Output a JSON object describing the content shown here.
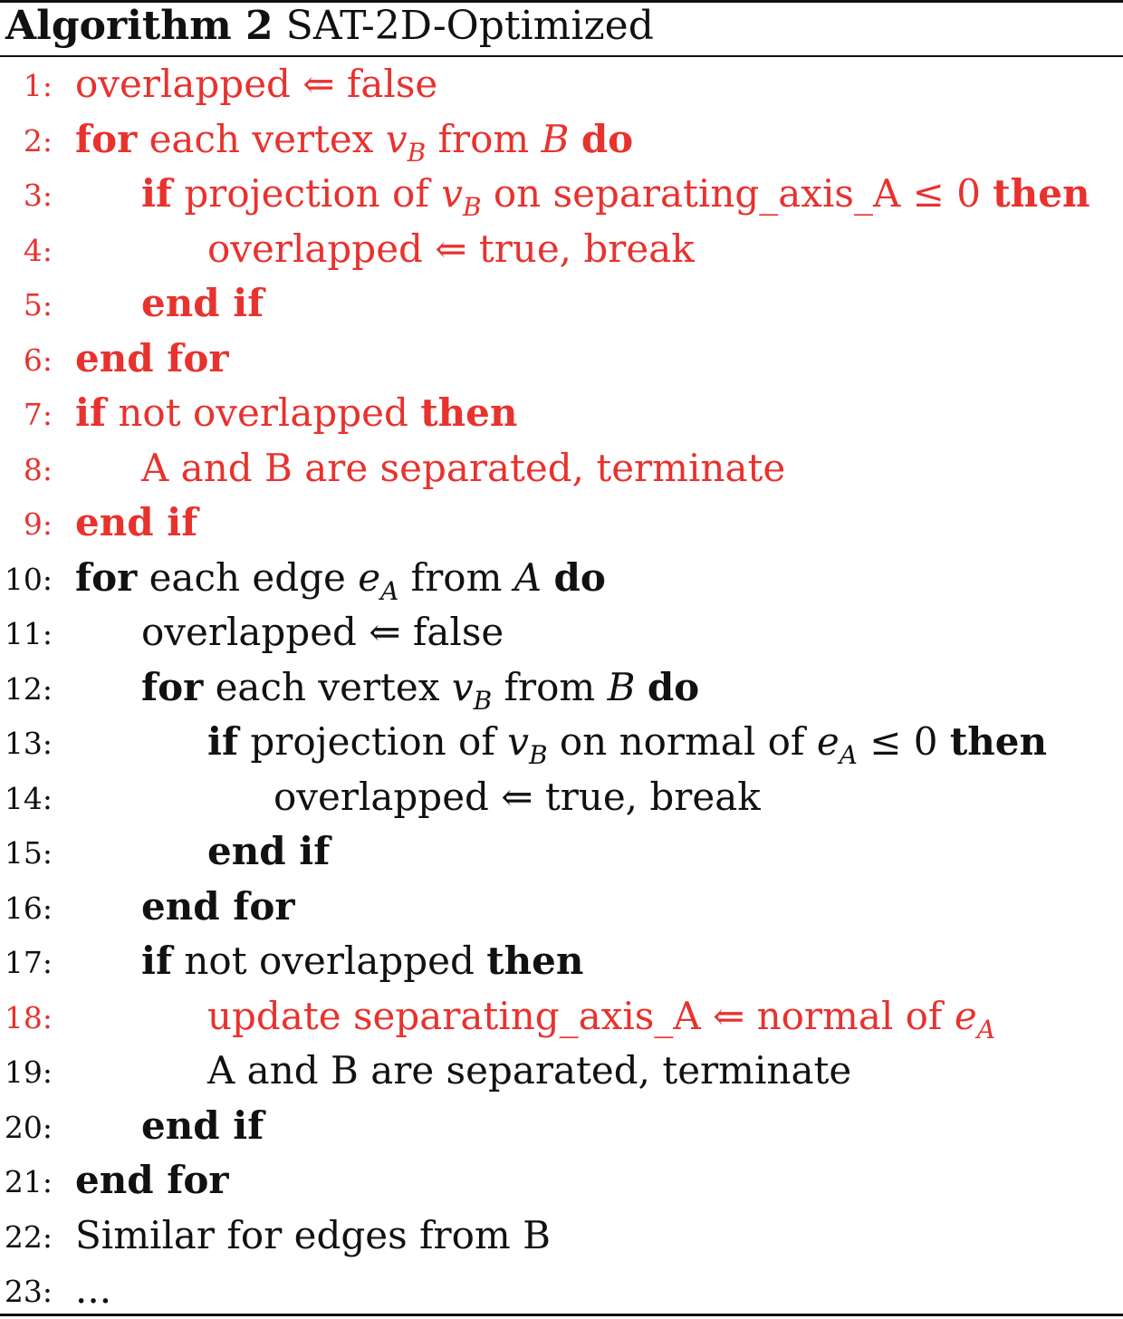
{
  "caption": {
    "label": "Algorithm 2",
    "title": "SAT-2D-Optimized"
  },
  "colors": {
    "text": "#111111",
    "highlight": "#e8322e"
  },
  "lines": [
    {
      "num": "1:",
      "indent": 0,
      "red": true,
      "parts": [
        [
          "t",
          "overlapped ⇐ false"
        ]
      ]
    },
    {
      "num": "2:",
      "indent": 0,
      "red": true,
      "parts": [
        [
          "kw",
          "for"
        ],
        [
          "t",
          " each vertex "
        ],
        [
          "m",
          "v",
          "B"
        ],
        [
          "t",
          " from "
        ],
        [
          "m",
          "B"
        ],
        [
          "t",
          " "
        ],
        [
          "kw",
          "do"
        ]
      ]
    },
    {
      "num": "3:",
      "indent": 1,
      "red": true,
      "parts": [
        [
          "kw",
          "if"
        ],
        [
          "t",
          " projection of "
        ],
        [
          "m",
          "v",
          "B"
        ],
        [
          "t",
          " on separating_axis_A ≤ 0 "
        ],
        [
          "kw",
          "then"
        ]
      ]
    },
    {
      "num": "4:",
      "indent": 2,
      "red": true,
      "parts": [
        [
          "t",
          "overlapped ⇐ true, break"
        ]
      ]
    },
    {
      "num": "5:",
      "indent": 1,
      "red": true,
      "parts": [
        [
          "kw",
          "end if"
        ]
      ]
    },
    {
      "num": "6:",
      "indent": 0,
      "red": true,
      "parts": [
        [
          "kw",
          "end for"
        ]
      ]
    },
    {
      "num": "7:",
      "indent": 0,
      "red": true,
      "parts": [
        [
          "kw",
          "if"
        ],
        [
          "t",
          " not overlapped "
        ],
        [
          "kw",
          "then"
        ]
      ]
    },
    {
      "num": "8:",
      "indent": 1,
      "red": true,
      "parts": [
        [
          "t",
          "A and B are separated, terminate"
        ]
      ]
    },
    {
      "num": "9:",
      "indent": 0,
      "red": true,
      "parts": [
        [
          "kw",
          "end if"
        ]
      ]
    },
    {
      "num": "10:",
      "indent": 0,
      "red": false,
      "parts": [
        [
          "kw",
          "for"
        ],
        [
          "t",
          " each edge "
        ],
        [
          "m",
          "e",
          "A"
        ],
        [
          "t",
          " from "
        ],
        [
          "m",
          "A"
        ],
        [
          "t",
          " "
        ],
        [
          "kw",
          "do"
        ]
      ]
    },
    {
      "num": "11:",
      "indent": 1,
      "red": false,
      "parts": [
        [
          "t",
          "overlapped ⇐ false"
        ]
      ]
    },
    {
      "num": "12:",
      "indent": 1,
      "red": false,
      "parts": [
        [
          "kw",
          "for"
        ],
        [
          "t",
          " each vertex "
        ],
        [
          "m",
          "v",
          "B"
        ],
        [
          "t",
          " from "
        ],
        [
          "m",
          "B"
        ],
        [
          "t",
          " "
        ],
        [
          "kw",
          "do"
        ]
      ]
    },
    {
      "num": "13:",
      "indent": 2,
      "red": false,
      "parts": [
        [
          "kw",
          "if"
        ],
        [
          "t",
          " projection of "
        ],
        [
          "m",
          "v",
          "B"
        ],
        [
          "t",
          " on normal of "
        ],
        [
          "m",
          "e",
          "A"
        ],
        [
          "t",
          " ≤ 0 "
        ],
        [
          "kw",
          "then"
        ]
      ]
    },
    {
      "num": "14:",
      "indent": 3,
      "red": false,
      "parts": [
        [
          "t",
          "overlapped ⇐ true, break"
        ]
      ]
    },
    {
      "num": "15:",
      "indent": 2,
      "red": false,
      "parts": [
        [
          "kw",
          "end if"
        ]
      ]
    },
    {
      "num": "16:",
      "indent": 1,
      "red": false,
      "parts": [
        [
          "kw",
          "end for"
        ]
      ]
    },
    {
      "num": "17:",
      "indent": 1,
      "red": false,
      "parts": [
        [
          "kw",
          "if"
        ],
        [
          "t",
          " not overlapped "
        ],
        [
          "kw",
          "then"
        ]
      ]
    },
    {
      "num": "18:",
      "indent": 2,
      "red": true,
      "parts": [
        [
          "t",
          "update separating_axis_A ⇐ normal of "
        ],
        [
          "m",
          "e",
          "A"
        ]
      ]
    },
    {
      "num": "19:",
      "indent": 2,
      "red": false,
      "parts": [
        [
          "t",
          "A and B are separated, terminate"
        ]
      ]
    },
    {
      "num": "20:",
      "indent": 1,
      "red": false,
      "parts": [
        [
          "kw",
          "end if"
        ]
      ]
    },
    {
      "num": "21:",
      "indent": 0,
      "red": false,
      "parts": [
        [
          "kw",
          "end for"
        ]
      ]
    },
    {
      "num": "22:",
      "indent": 0,
      "red": false,
      "parts": [
        [
          "t",
          "Similar for edges from B"
        ]
      ]
    },
    {
      "num": "23:",
      "indent": 0,
      "red": false,
      "parts": [
        [
          "t",
          "..."
        ]
      ]
    }
  ]
}
